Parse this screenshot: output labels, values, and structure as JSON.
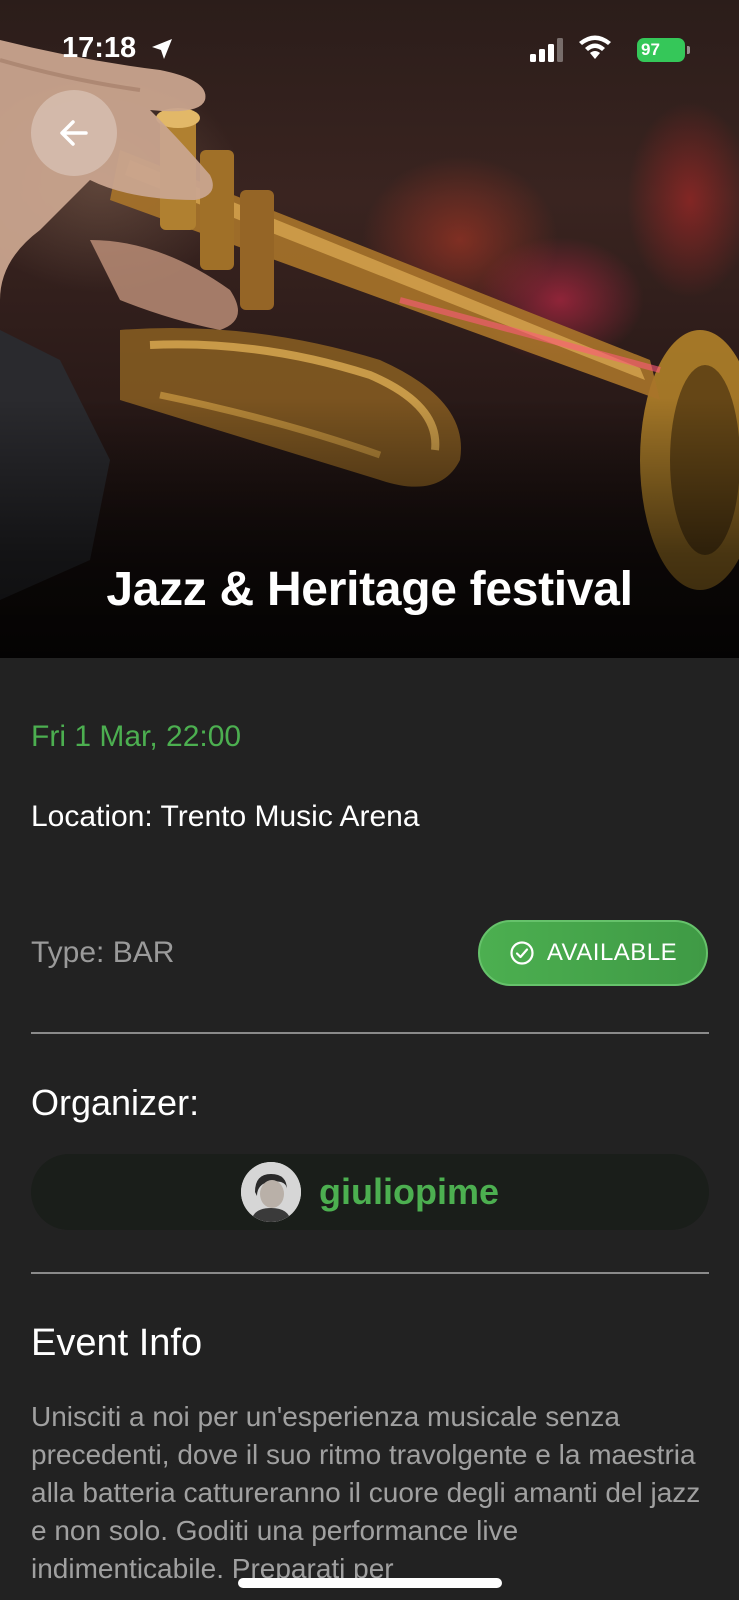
{
  "status_bar": {
    "time": "17:18",
    "battery": "97"
  },
  "hero": {
    "title": "Jazz & Heritage festival"
  },
  "event": {
    "date": "Fri 1 Mar, 22:00",
    "location": "Location: Trento Music Arena",
    "type": "Type: BAR",
    "availability": "AVAILABLE"
  },
  "organizer": {
    "heading": "Organizer:",
    "username": "giuliopime"
  },
  "info": {
    "heading": "Event Info",
    "body": "Unisciti a noi per un'esperienza musicale senza precedenti, dove il suo ritmo travolgente e la maestria alla batteria cattureranno il cuore degli amanti del jazz e non solo. Goditi una performance live indimenticabile. Preparati per"
  },
  "colors": {
    "accent": "#4caf50",
    "background": "#222222",
    "battery": "#35c759"
  }
}
